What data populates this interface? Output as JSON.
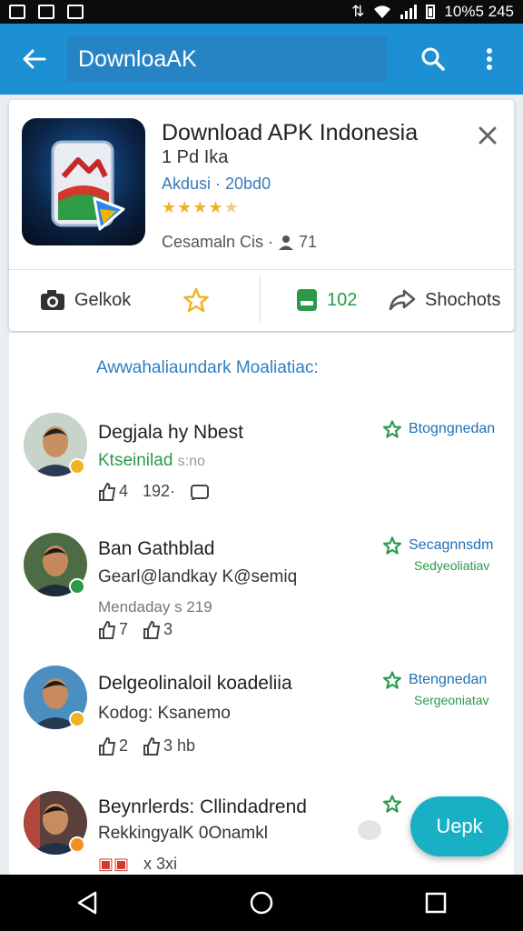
{
  "status_bar": {
    "left_icons": [
      "notification-icon",
      "image-icon",
      "photo-icon"
    ],
    "text": "10%5 245"
  },
  "toolbar": {
    "search_value": "DownloaAK"
  },
  "app": {
    "title": "Download APK Indonesia",
    "subtitle": "1 Pd Ika",
    "developer": "Akdusi · 20bd0",
    "rating": 4.5,
    "meta": "Cesamaln Cis ·",
    "meta_count": "71",
    "actions": [
      {
        "label": "Gelkok",
        "icon": "camera-icon"
      },
      {
        "label": "",
        "icon": "star-icon"
      },
      {
        "label": "102",
        "icon": "android-icon"
      },
      {
        "label": "Shochots",
        "icon": "share-icon"
      }
    ]
  },
  "section_link": "Awwahaliaundark Moaliatiac:",
  "reviews": [
    {
      "name": "Degjala hy Nbest",
      "line": "Ktseinilad",
      "line_extra": "s:no",
      "meta": "",
      "likes": "4",
      "count": "192·",
      "right_label": "Btogngnedan",
      "right_sub": ""
    },
    {
      "name": "Ban Gathblad",
      "line": "Gearl@landkay K@semiq",
      "line_extra": "",
      "meta": "Mendaday s 219",
      "likes": "7",
      "count": "3",
      "right_label": "Secagnnsdm",
      "right_sub": "Sedyeoliatiav"
    },
    {
      "name": "Delgeolinaloil koadeliia",
      "line": "Kodog: Ksanemo",
      "line_extra": "",
      "meta": "",
      "likes": "2",
      "count": "3 hb",
      "right_label": "Btengnedan",
      "right_sub": "Sergeoniatav"
    },
    {
      "name": "Beynrlerds: Cllindadrend",
      "line": "RekkingyalK 0Onamkl",
      "line_extra": "",
      "meta": "",
      "likes": "",
      "count": "x 3xi",
      "right_label": "",
      "right_sub": ""
    }
  ],
  "fab": {
    "label": "Uepk"
  },
  "colors": {
    "appbar": "#1d8fd3",
    "fab": "#17b0c4",
    "star": "#f2b322",
    "link": "#2f7ec0",
    "green": "#2a9a4a"
  }
}
